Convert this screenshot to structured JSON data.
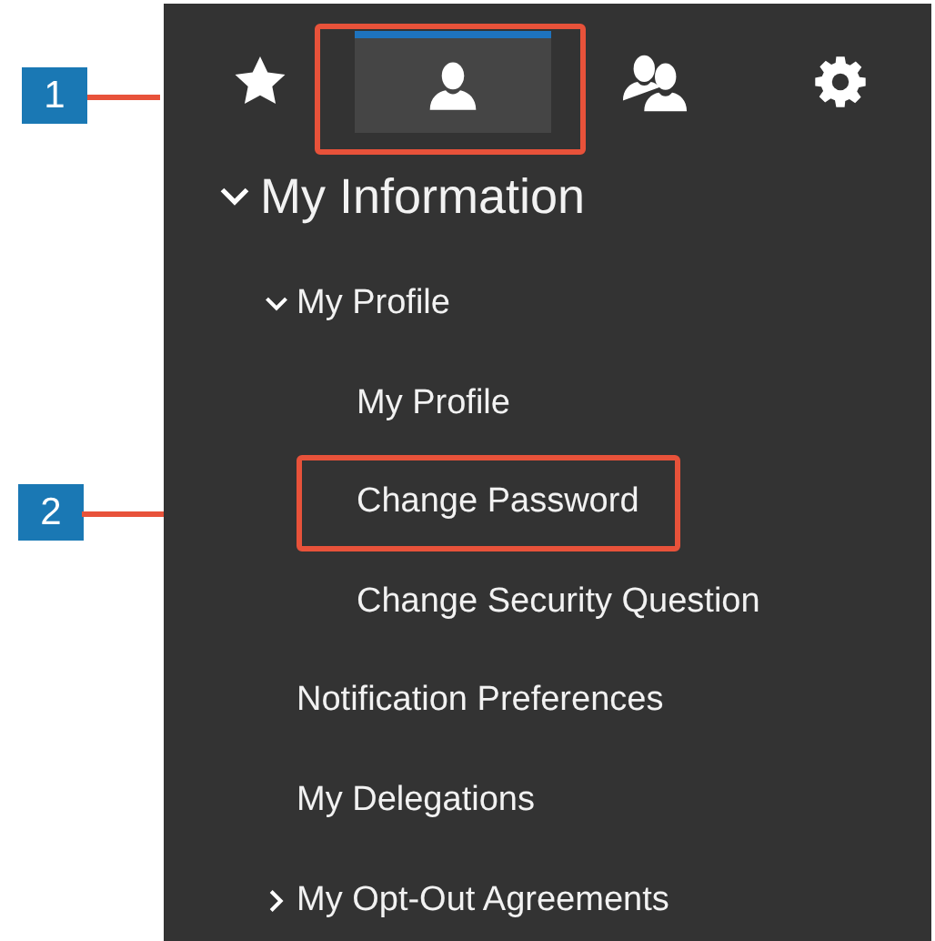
{
  "callouts": [
    {
      "label": "1"
    },
    {
      "label": "2"
    }
  ],
  "tabs": [
    {
      "kind": "favorites",
      "selected": false,
      "highlighted": false
    },
    {
      "kind": "user",
      "selected": true,
      "highlighted": true
    },
    {
      "kind": "team",
      "selected": false,
      "highlighted": false
    },
    {
      "kind": "settings",
      "selected": false,
      "highlighted": false
    }
  ],
  "tree": [
    {
      "label": "My Information",
      "expanded": true,
      "children": [
        {
          "label": "My Profile",
          "expanded": true,
          "children": [
            {
              "label": "My Profile",
              "highlighted": false
            },
            {
              "label": "Change Password",
              "highlighted": true
            },
            {
              "label": "Change Security Question",
              "highlighted": false
            }
          ]
        },
        {
          "label": "Notification Preferences"
        },
        {
          "label": "My Delegations"
        },
        {
          "label": "My Opt-Out Agreements",
          "expanded": false
        }
      ]
    }
  ]
}
